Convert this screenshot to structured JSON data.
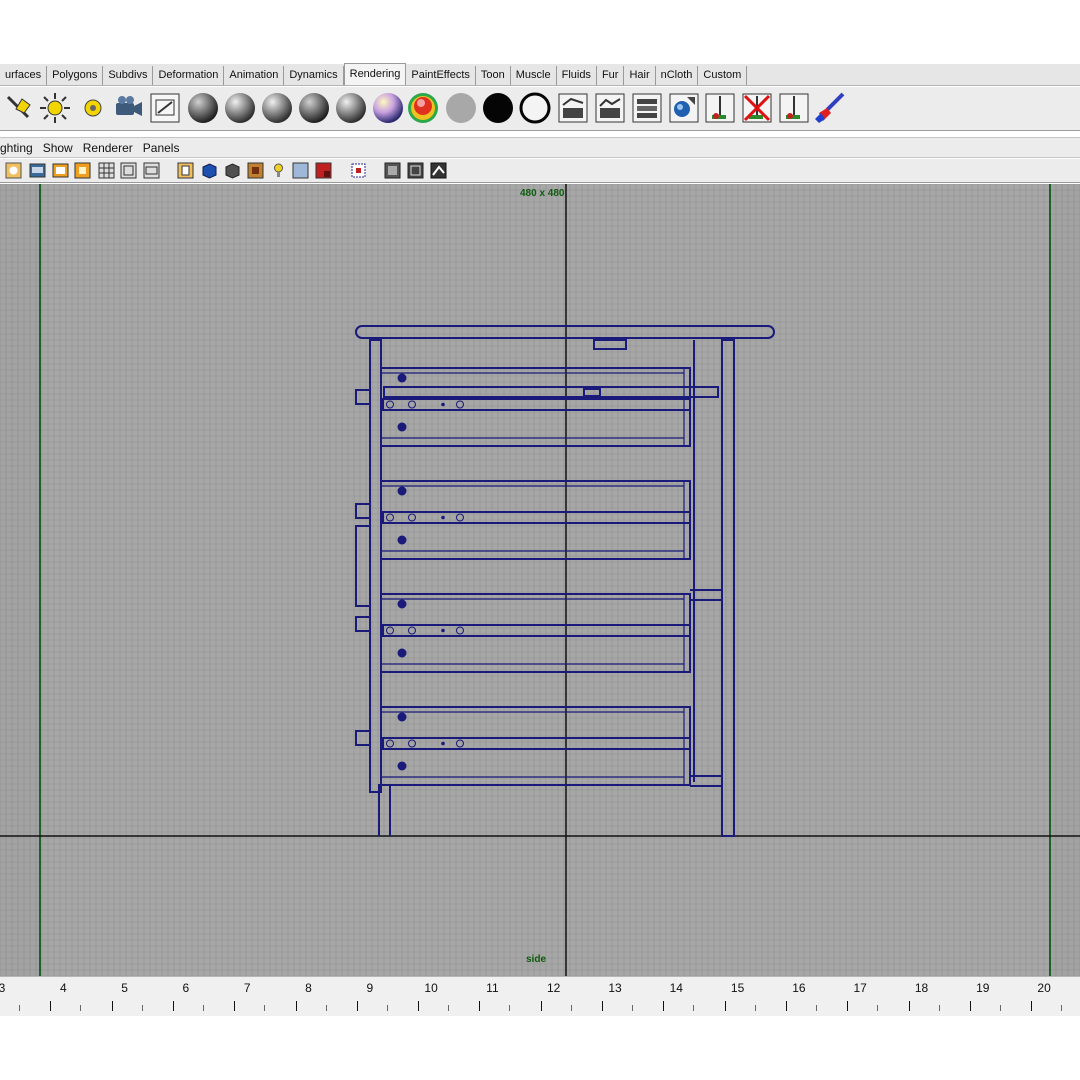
{
  "shelf_tabs": [
    "urfaces",
    "Polygons",
    "Subdivs",
    "Deformation",
    "Animation",
    "Dynamics",
    "Rendering",
    "PaintEffects",
    "Toon",
    "Muscle",
    "Fluids",
    "Fur",
    "Hair",
    "nCloth",
    "Custom"
  ],
  "active_tab": "Rendering",
  "shelf_icons": [
    "spot-light-icon",
    "point-light-icon",
    "ambient-light-icon",
    "camera-icon",
    "render-settings-icon",
    "lambert-sphere-icon",
    "blinn-sphere-icon",
    "phong-sphere-icon",
    "phonge-sphere-icon",
    "anisotropic-sphere-icon",
    "layered-shader-icon",
    "ramp-shader-icon",
    "shading-map-icon",
    "surface-shader-icon",
    "use-background-icon",
    "render-view-icon",
    "render-current-frame-icon",
    "ipr-render-icon",
    "hypershade-icon",
    "light-linking-icon",
    "break-light-links-icon",
    "make-light-links-icon",
    "paint-effects-brush-icon"
  ],
  "panel_menu": [
    "ghting",
    "Show",
    "Renderer",
    "Panels"
  ],
  "panel_toolbar_icons": [
    "select-camera-icon",
    "camera-attributes-icon",
    "bookmark-icon",
    "image-plane-icon",
    "grid-icon",
    "film-gate-icon",
    "resolution-gate-icon",
    "gate-mask-icon",
    "field-chart-icon",
    "safe-action-icon",
    "wireframe-icon",
    "smooth-shade-icon",
    "flat-shade-icon",
    "texture-icon",
    "lighting-icon",
    "shadows-icon",
    "xray-icon",
    "isolate-select-icon",
    "hud-icon",
    "resolution-icon",
    "snapshot-icon"
  ],
  "viewport": {
    "resolution_label": "480 x 480",
    "camera_label": "side",
    "wire_color": "#1a1a7a",
    "grid_color": "#8f8f8f",
    "gate_color": "#1f5f2a"
  },
  "ruler": {
    "labels": [
      "3",
      "4",
      "5",
      "6",
      "7",
      "8",
      "9",
      "10",
      "11",
      "12",
      "13",
      "14",
      "15",
      "16",
      "17",
      "18",
      "19",
      "20"
    ]
  }
}
